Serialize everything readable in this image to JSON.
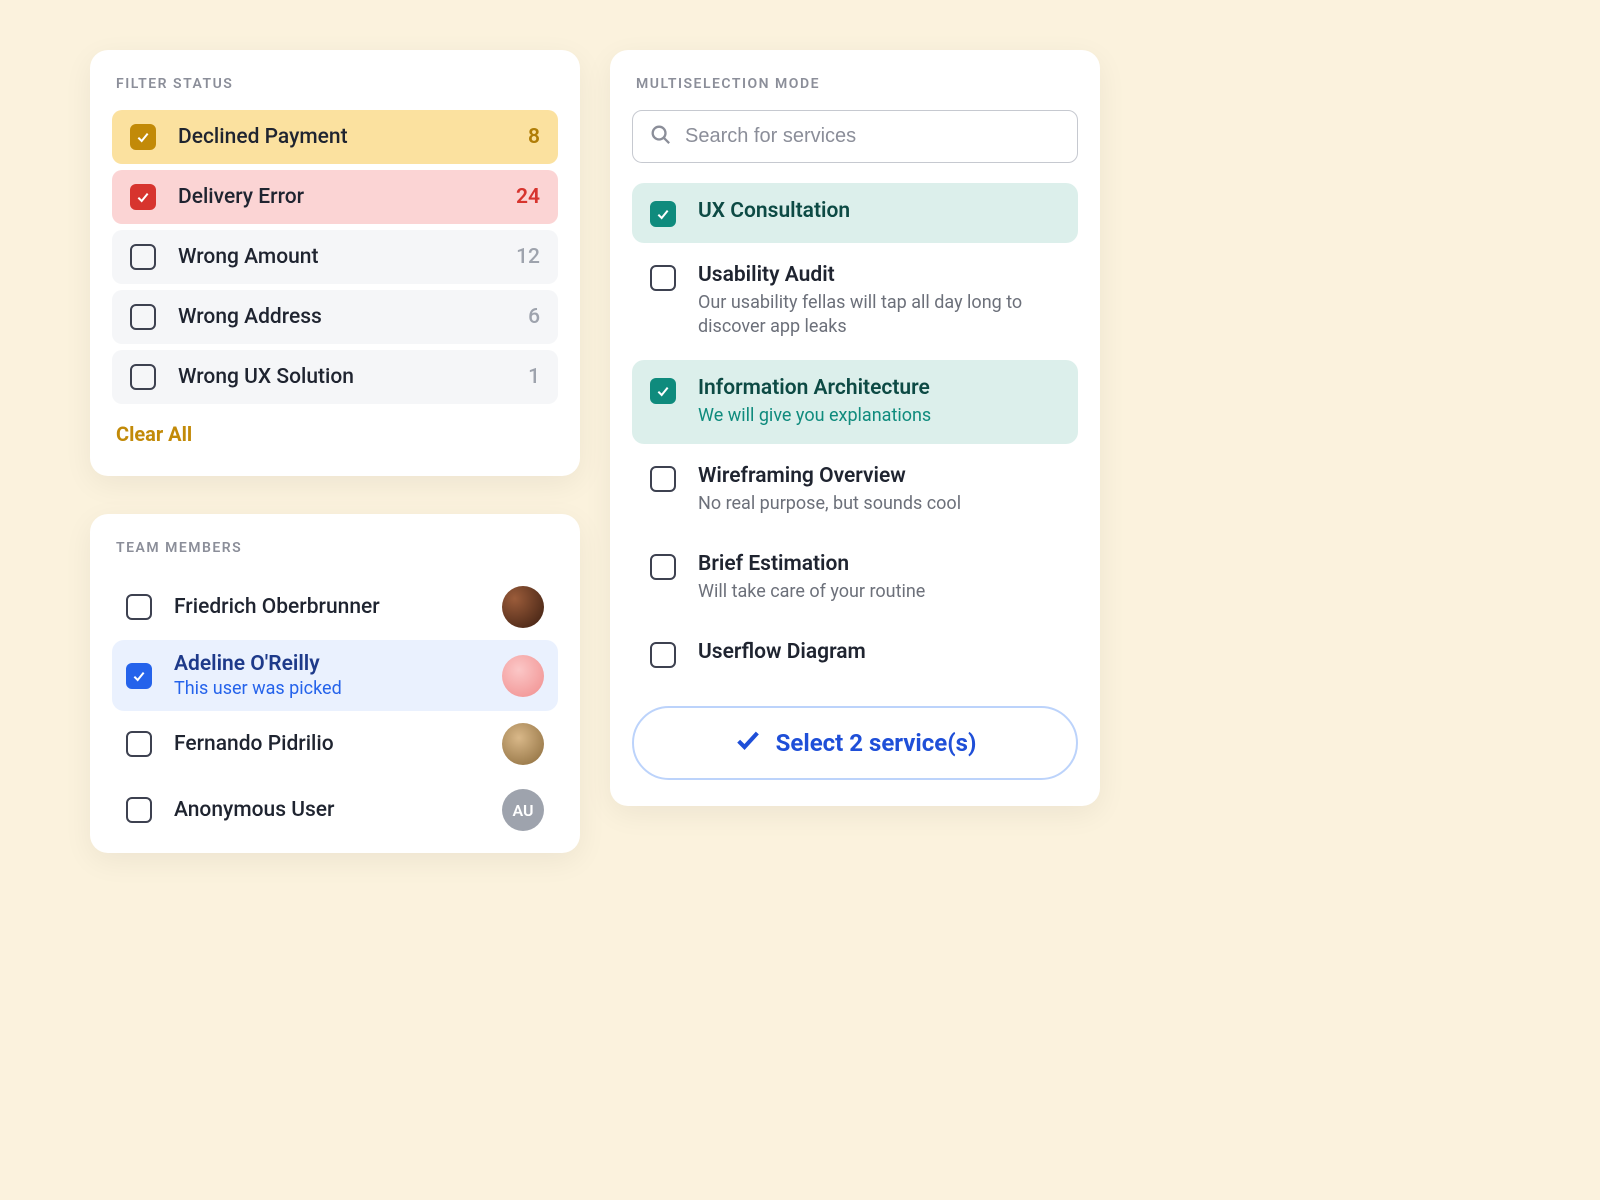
{
  "filter": {
    "heading": "FILTER STATUS",
    "items": [
      {
        "label": "Declined Payment",
        "count": "8"
      },
      {
        "label": "Delivery Error",
        "count": "24"
      },
      {
        "label": "Wrong Amount",
        "count": "12"
      },
      {
        "label": "Wrong Address",
        "count": "6"
      },
      {
        "label": "Wrong UX Solution",
        "count": "1"
      }
    ],
    "clear_label": "Clear All"
  },
  "team": {
    "heading": "TEAM MEMBERS",
    "members": [
      {
        "name": "Friedrich Oberbrunner"
      },
      {
        "name": "Adeline O'Reilly",
        "subtitle": "This user was picked"
      },
      {
        "name": "Fernando Pidrilio"
      },
      {
        "name": "Anonymous User",
        "initials": "AU"
      }
    ]
  },
  "services": {
    "heading": "MULTISELECTION MODE",
    "search_placeholder": "Search for services",
    "items": [
      {
        "title": "UX Consultation"
      },
      {
        "title": "Usability Audit",
        "desc": "Our usability fellas will tap all day long to discover app leaks"
      },
      {
        "title": "Information Architecture",
        "desc": "We will give you explanations"
      },
      {
        "title": "Wireframing Overview",
        "desc": "No real purpose, but sounds cool"
      },
      {
        "title": "Brief Estimation",
        "desc": "Will take care of your routine"
      },
      {
        "title": "Userflow Diagram"
      }
    ],
    "cta_label": "Select 2 service(s)"
  }
}
